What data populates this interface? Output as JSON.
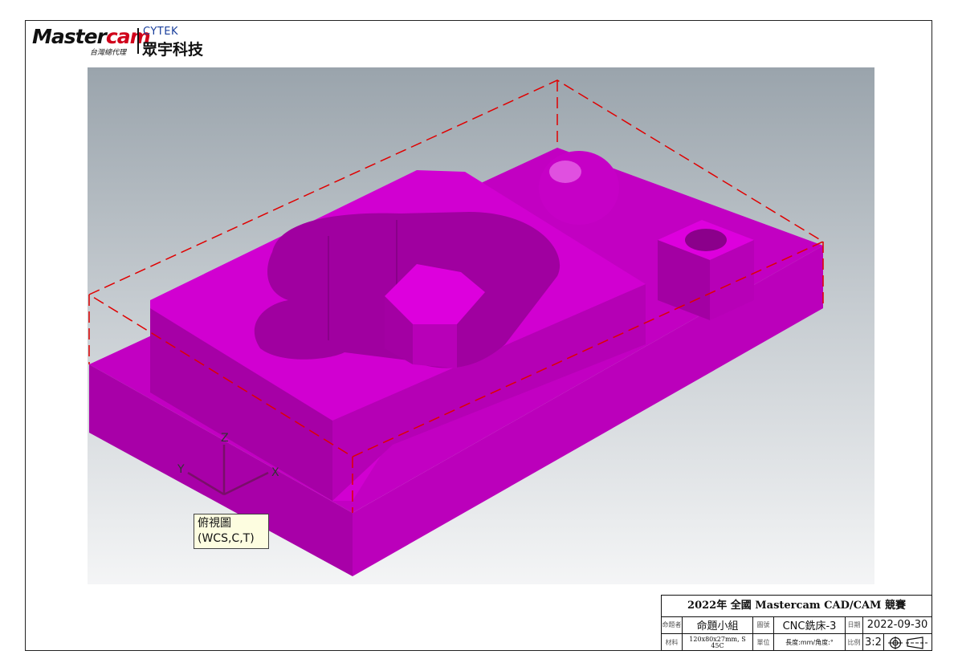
{
  "brand": {
    "logo_left": "Master",
    "logo_accent": "cam",
    "logo_sub": "台灣總代理",
    "partner": "CYTEK",
    "partner_cn": "眾宇科技"
  },
  "viewport": {
    "view_label_line1": "俯視圖",
    "view_label_line2": "(WCS,C,T)",
    "axis_x": "X",
    "axis_y": "Y",
    "axis_z": "Z",
    "part_color": "#cc00cc",
    "bbox_color": "#e00000"
  },
  "title_block": {
    "title": "2022年 全國 Mastercam CAD/CAM 競賽",
    "row1": {
      "author_label": "命題者",
      "author_value": "命題小組",
      "drawing_label": "圖號",
      "drawing_value": "CNC銑床-3",
      "date_label": "日期",
      "date_value": "2022-09-30"
    },
    "row2": {
      "material_label": "材料",
      "material_value": "120x80x27mm, S 45C",
      "unit_label": "單位",
      "unit_value": "長度:mm/角度:°",
      "scale_label": "比例",
      "scale_value": "3:2"
    }
  }
}
